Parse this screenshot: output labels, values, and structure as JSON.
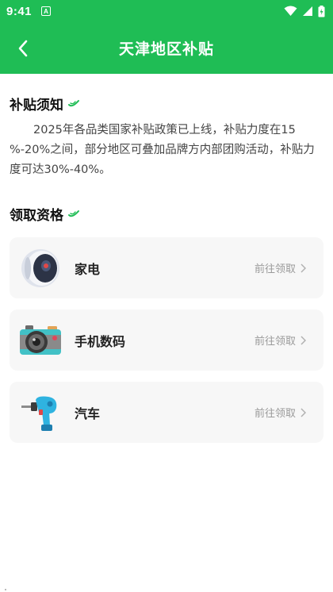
{
  "status_bar": {
    "time": "9:41",
    "notification_badge": "A"
  },
  "header": {
    "title": "天津地区补贴"
  },
  "notice": {
    "title": "补贴须知",
    "text": "2025年各品类国家补贴政策已上线，补贴力度在15 %-20%之间，部分地区可叠加品牌方内部团购活动，补贴力度可达30%-40%。"
  },
  "eligibility": {
    "title": "领取资格",
    "items": [
      {
        "label": "家电",
        "action": "前往领取",
        "icon": "robot-vacuum-icon"
      },
      {
        "label": "手机数码",
        "action": "前往领取",
        "icon": "camera-icon"
      },
      {
        "label": "汽车",
        "action": "前往领取",
        "icon": "power-drill-icon"
      }
    ]
  },
  "colors": {
    "brand_green": "#1fbd55",
    "card_bg": "#f7f7f7"
  }
}
